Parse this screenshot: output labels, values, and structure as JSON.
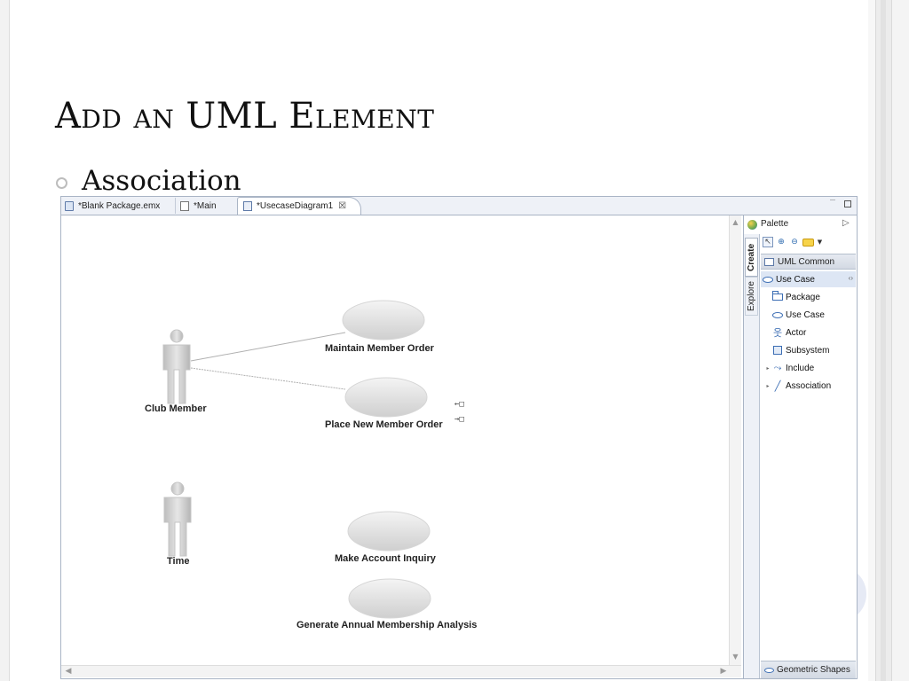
{
  "slide": {
    "title": "Add an UML Element",
    "bullet": "Association"
  },
  "editor": {
    "tabs": [
      {
        "label": "*Blank Package.emx"
      },
      {
        "label": "*Main"
      },
      {
        "label": "*UsecaseDiagram1",
        "close": "☒"
      }
    ]
  },
  "diagram": {
    "actors": [
      {
        "name": "Club Member"
      },
      {
        "name": "Time"
      }
    ],
    "usecases": [
      {
        "name": "Maintain Member Order"
      },
      {
        "name": "Place New Member Order"
      },
      {
        "name": "Make Account Inquiry"
      },
      {
        "name": "Generate Annual Membership Analysis"
      }
    ],
    "handles": [
      "←□",
      "→□"
    ]
  },
  "palette": {
    "title": "Palette",
    "tabs": {
      "create": "Create",
      "explore": "Explore"
    },
    "drawer": "UML Common",
    "stack_selected": "Use Case",
    "items": [
      {
        "label": "Package",
        "icon": "package-icon"
      },
      {
        "label": "Use Case",
        "icon": "usecase-icon"
      },
      {
        "label": "Actor",
        "icon": "actor-icon"
      },
      {
        "label": "Subsystem",
        "icon": "subsystem-icon"
      },
      {
        "label": "Include",
        "icon": "include-icon"
      },
      {
        "label": "Association",
        "icon": "association-icon"
      }
    ],
    "footer": "Geometric Shapes"
  }
}
